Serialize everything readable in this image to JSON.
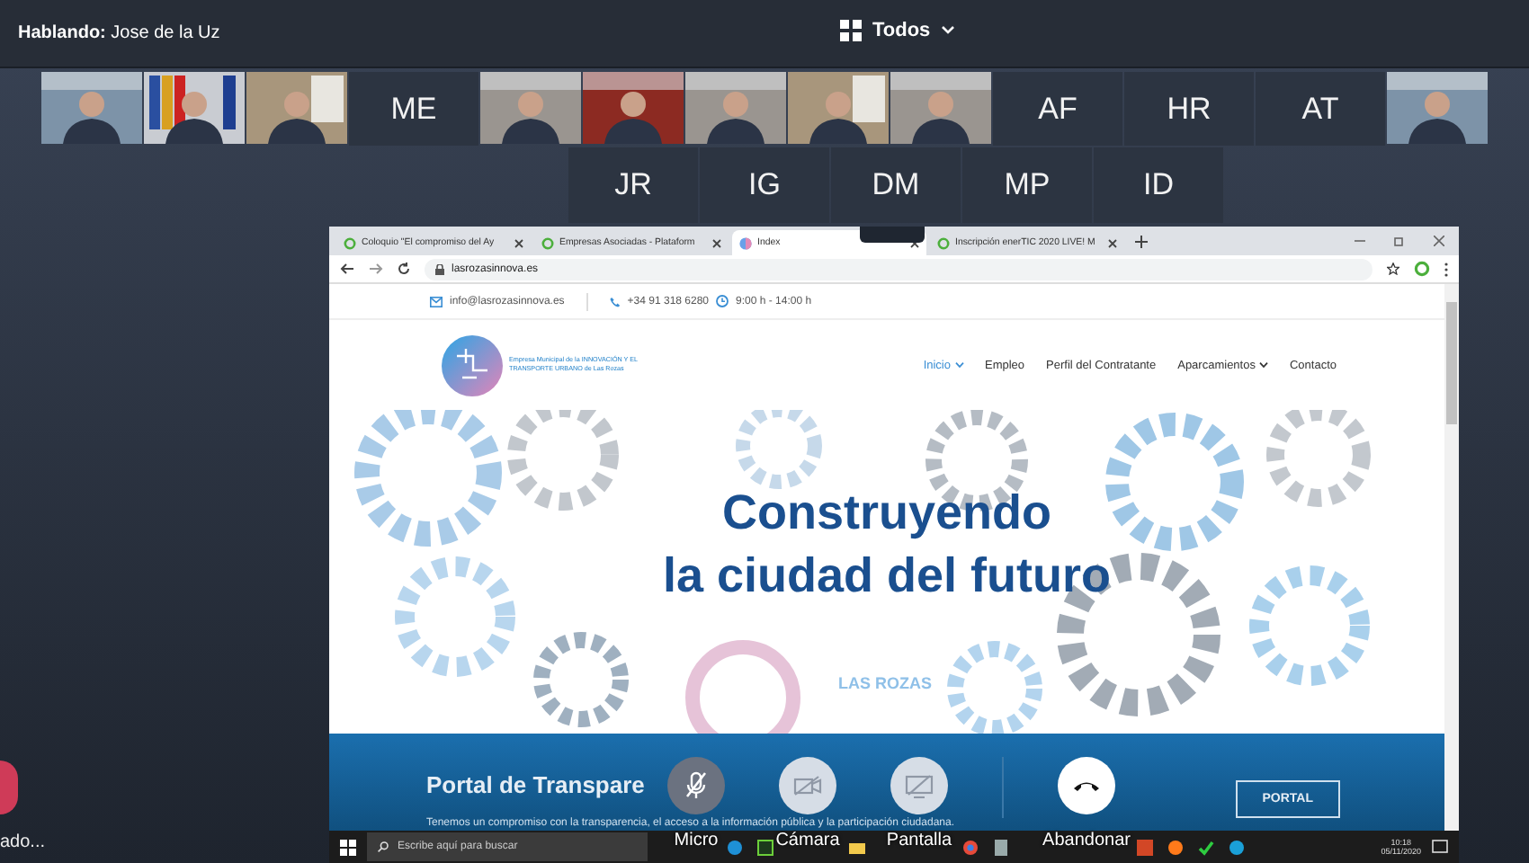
{
  "top_bar": {
    "speaker_label": "Hablando:",
    "speaker": "Jose de la Uz",
    "view": "Todos"
  },
  "participants_row1": [
    {
      "kind": "video"
    },
    {
      "kind": "video"
    },
    {
      "kind": "video"
    },
    {
      "kind": "initials",
      "initials": "ME"
    },
    {
      "kind": "video"
    },
    {
      "kind": "video"
    },
    {
      "kind": "video"
    },
    {
      "kind": "video"
    },
    {
      "kind": "video"
    },
    {
      "kind": "initials",
      "initials": "AF"
    },
    {
      "kind": "initials",
      "initials": "HR"
    },
    {
      "kind": "initials",
      "initials": "AT"
    },
    {
      "kind": "video"
    }
  ],
  "participants_row2": [
    {
      "kind": "initials",
      "initials": "JR"
    },
    {
      "kind": "initials",
      "initials": "IG"
    },
    {
      "kind": "initials",
      "initials": "DM"
    },
    {
      "kind": "initials",
      "initials": "MP"
    },
    {
      "kind": "initials",
      "initials": "ID"
    }
  ],
  "shared_screen": {
    "tabs": [
      {
        "title": "Coloquio \"El compromiso del Ay",
        "selected": false,
        "kind": "site"
      },
      {
        "title": "Empresas Asociadas - Plataform",
        "selected": false,
        "kind": "site"
      },
      {
        "title": "Index",
        "selected": true,
        "kind": "globe"
      },
      {
        "title": "Inscripción enerTIC 2020 LIVE! M",
        "selected": false,
        "kind": "site"
      }
    ],
    "url": "lasrozasinnova.es",
    "contact": {
      "email": "info@lasrozasinnova.es",
      "phone": "+34 91 318 6280",
      "hours": "9:00 h - 14:00 h"
    },
    "logo_text": "Empresa Municipal de la INNOVACIÓN Y EL TRANSPORTE URBANO de Las Rozas",
    "nav": [
      {
        "label": "Inicio",
        "selected": true,
        "dropdown": true
      },
      {
        "label": "Empleo",
        "selected": false,
        "dropdown": false
      },
      {
        "label": "Perfil del Contratante",
        "selected": false,
        "dropdown": false
      },
      {
        "label": "Aparcamientos",
        "selected": false,
        "dropdown": true
      },
      {
        "label": "Contacto",
        "selected": false,
        "dropdown": false
      }
    ],
    "hero": {
      "line1": "Construyendo",
      "line2": "la ciudad del futuro",
      "badge": "LAS ROZAS"
    },
    "portal": {
      "title": "Portal de Transpare",
      "text": "Tenemos un compromiso con la transparencia, el acceso a la información pública y la participación ciudadana.",
      "button": "PORTAL"
    },
    "taskbar": {
      "search_placeholder": "Escribe aquí para buscar",
      "time": "10:18",
      "date": "05/11/2020"
    }
  },
  "controls": [
    {
      "kind": "mic",
      "label": "Micro"
    },
    {
      "kind": "camera",
      "label": "Cámara"
    },
    {
      "kind": "screen",
      "label": "Pantalla"
    },
    {
      "kind": "leave",
      "label": "Abandonar"
    }
  ],
  "other_caller": {
    "label": "ado..."
  }
}
